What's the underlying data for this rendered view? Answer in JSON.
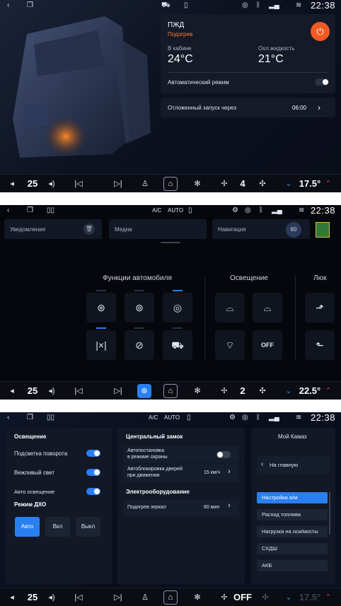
{
  "status": {
    "time": "22:38",
    "ac": "A/C",
    "auto": "AUTO"
  },
  "screen1": {
    "card": {
      "title": "ПЖД",
      "subtitle": "Подогрев",
      "cabin_label": "В кабине",
      "cabin_temp": "24°C",
      "coolant_label": "Охл.жидкость",
      "coolant_temp": "21°C",
      "auto_mode": "Автоматический режим"
    },
    "delayed": {
      "label": "Отложенный запуск через",
      "value": "06:00"
    },
    "bottom": {
      "volume": "25",
      "fan": "4",
      "temp": "17.5°"
    }
  },
  "screen2": {
    "tabs": [
      "Уведомления",
      "Медиа",
      "Навигация"
    ],
    "nav_badge": "60",
    "sections": {
      "functions": "Функции автомобиля",
      "lights": "Освещение",
      "hatch": "Люк"
    },
    "off_label": "OFF",
    "bottom": {
      "volume": "25",
      "fan": "2",
      "temp": "22.5°"
    }
  },
  "screen3": {
    "lights": {
      "title": "Освещение",
      "turn_signal": "Подсветка поворота",
      "courtesy": "Вежливый свет",
      "auto_light": "Авто освещение",
      "drl_title": "Режим ДХО",
      "modes": [
        "Авто",
        "Вкл",
        "Выкл"
      ]
    },
    "lock": {
      "title": "Центральный замок",
      "autostop": "Автопостановка\nв режиме охраны",
      "autolock": "Автоблокировка дверей\nпри движении",
      "autolock_value": "15 км/ч",
      "electro_title": "Электрооборудование",
      "mirrors": "Подогрев зеркал",
      "mirrors_value": "60 мин"
    },
    "menu": {
      "title": "Мой Камаз",
      "back": "На главную",
      "items": [
        "Настройки а/м",
        "Расход топлива",
        "Нагрузка на оси/мосты",
        "СХДШ",
        "АКБ"
      ]
    },
    "bottom": {
      "volume": "25",
      "fan": "OFF",
      "temp": "17.5°"
    }
  }
}
